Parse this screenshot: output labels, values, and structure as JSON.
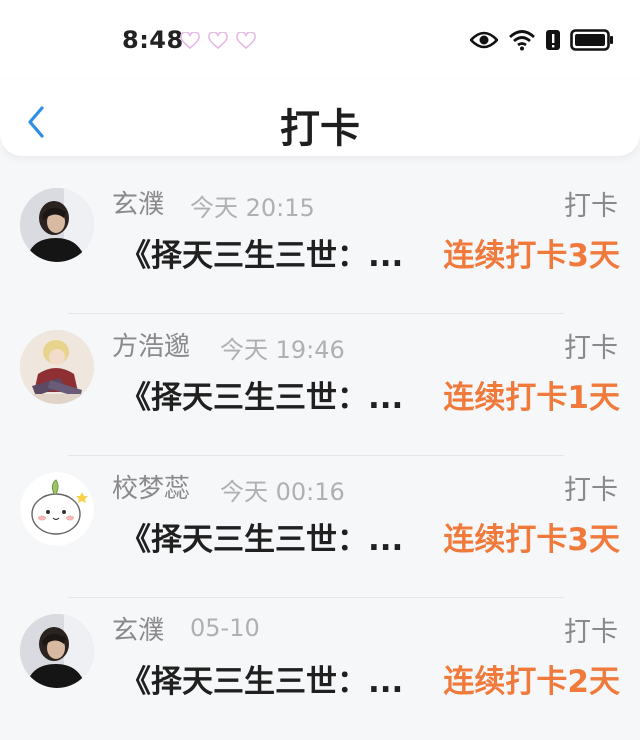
{
  "status_bar": {
    "time": "8:48",
    "icons": [
      "heart-icon",
      "heart-icon",
      "heart-icon",
      "eye-icon",
      "wifi-icon",
      "alert-icon",
      "battery-icon"
    ]
  },
  "header": {
    "title": "打卡",
    "back_icon": "chevron-left-icon",
    "accent_color": "#2f8fe8"
  },
  "records": [
    {
      "name": "玄濮",
      "time": "今天 20:15",
      "tag": "打卡",
      "book": "《择天三生三世：...",
      "streak": "连续打卡3天",
      "avatar": "avatar-dark-hair-person"
    },
    {
      "name": "方浩邈",
      "time": "今天 19:46",
      "tag": "打卡",
      "book": "《择天三生三世：...",
      "streak": "连续打卡1天",
      "avatar": "avatar-anime-character"
    },
    {
      "name": "校梦蕊",
      "time": "今天 00:16",
      "tag": "打卡",
      "book": "《择天三生三世：...",
      "streak": "连续打卡3天",
      "avatar": "avatar-cute-bun-sticker"
    },
    {
      "name": "玄濮",
      "time": "05-10",
      "tag": "打卡",
      "book": "《择天三生三世：...",
      "streak": "连续打卡2天",
      "avatar": "avatar-dark-hair-person"
    }
  ],
  "colors": {
    "streak": "#f07a3c",
    "name": "#8a8a8a",
    "time": "#b0b0b0"
  }
}
